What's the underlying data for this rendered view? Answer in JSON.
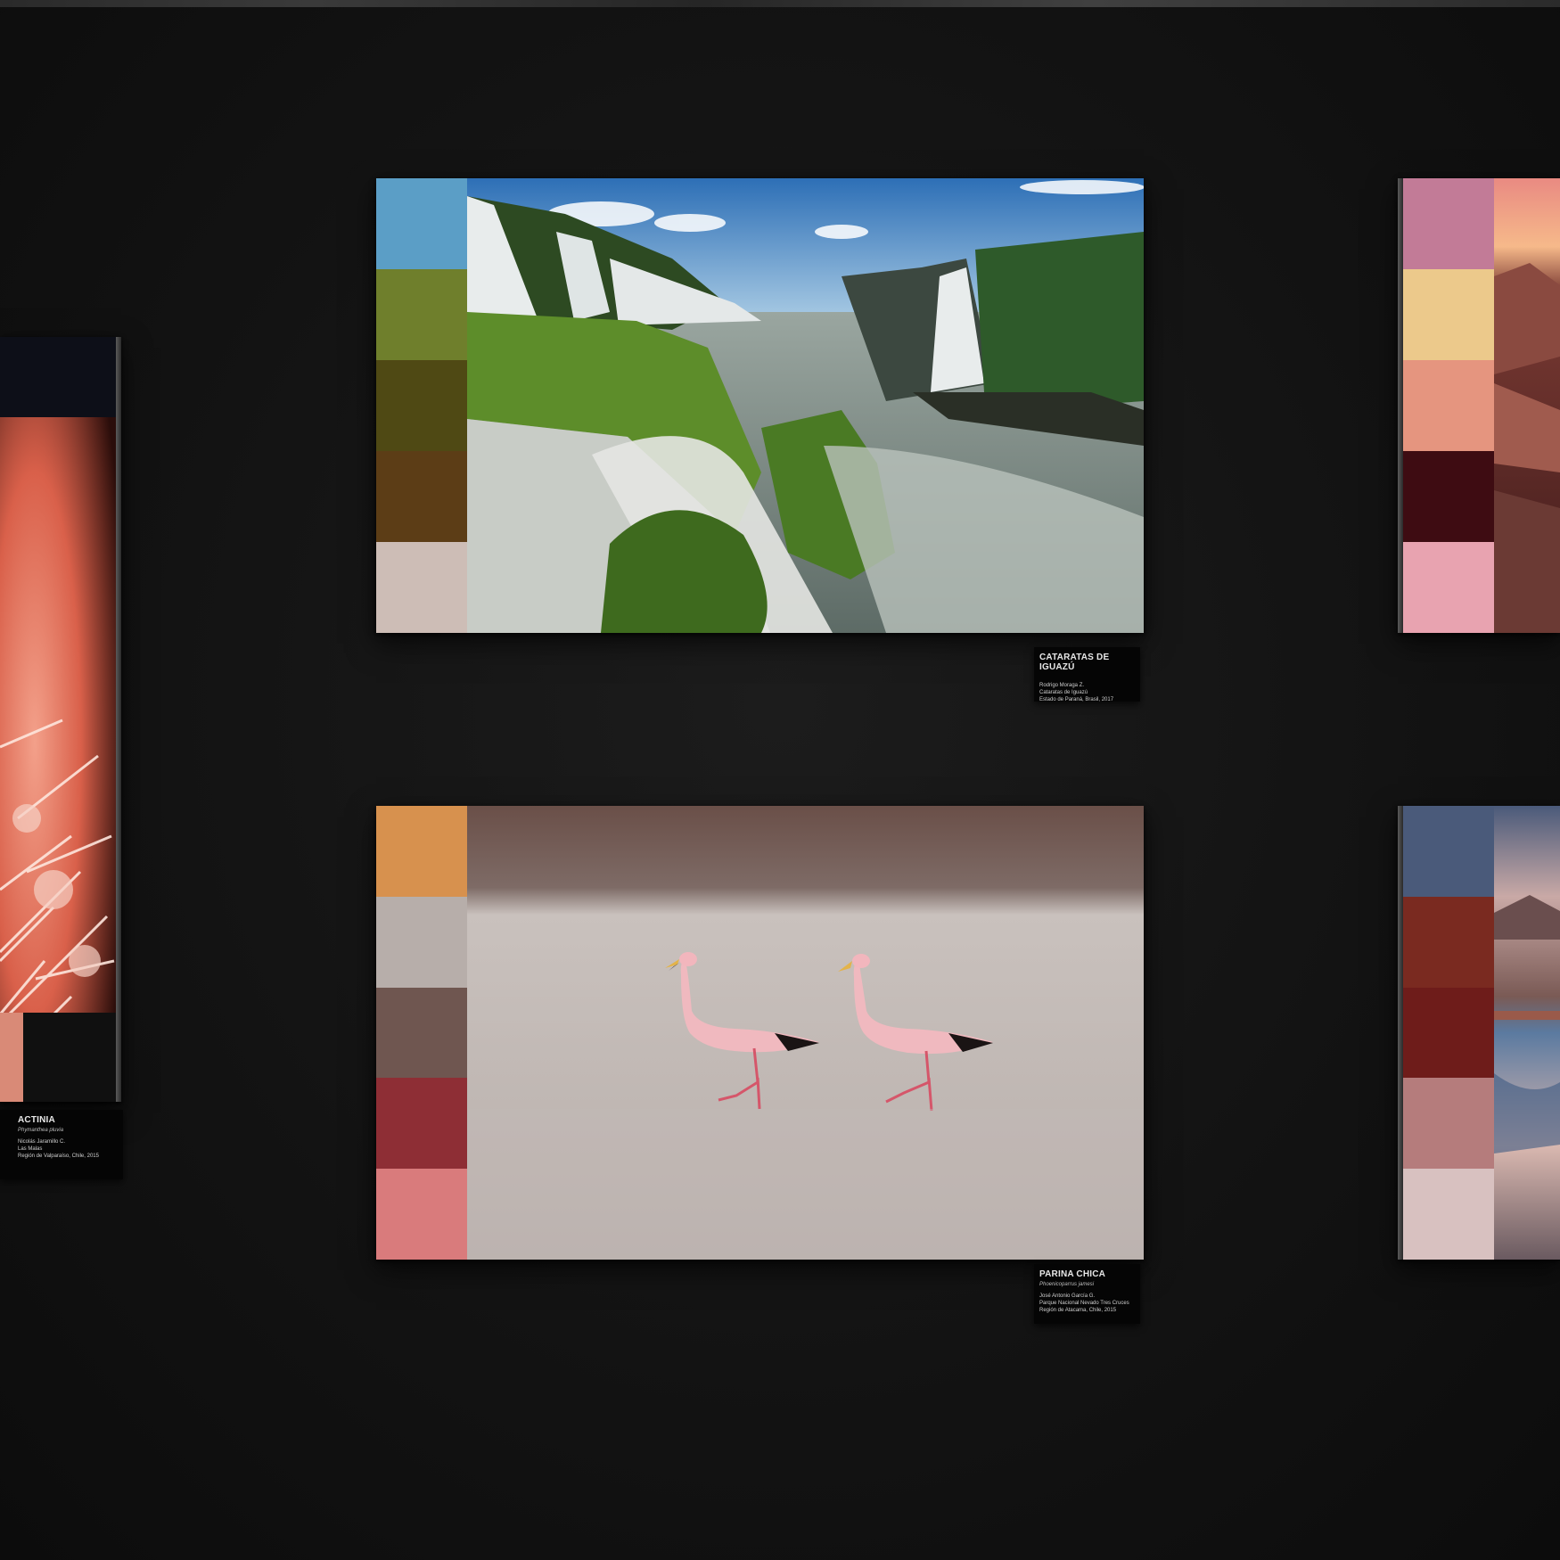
{
  "gallery": {
    "center_top": {
      "title": "CATARATAS DE IGUAZÚ",
      "lines": [
        "Rodrigo Moraga Z.",
        "Cataratas de Iguazú",
        "Estado de Paraná, Brasil, 2017"
      ],
      "palette": [
        "#5b9ec6",
        "#6f7f2c",
        "#4f4914",
        "#5c3d16",
        "#cdbdb6"
      ]
    },
    "center_bottom": {
      "title": "PARINA CHICA",
      "subtitle": "Phoenicoparrus jamesi",
      "lines": [
        "José Antonio García G.",
        "Parque Nacional Nevado Tres Cruces",
        "Región de Atacama, Chile, 2015"
      ],
      "palette": [
        "#d7914e",
        "#b7aeaa",
        "#6f5650",
        "#8e2e35",
        "#d97b7c"
      ]
    },
    "left": {
      "title": "ACTINIA",
      "subtitle": "Phymanthea pluvia",
      "lines": [
        "Nicolás Jaramillo C.",
        "Las Malas",
        "Región de Valparaíso, Chile, 2015"
      ],
      "palette": [
        "#d98a77",
        "#101010"
      ]
    },
    "right_top": {
      "palette": [
        "#c27b97",
        "#ecc98b",
        "#e5957f",
        "#3e0c12",
        "#e8a3b0"
      ]
    },
    "right_bottom": {
      "palette": [
        "#4a5a7a",
        "#7a2a20",
        "#6e1c1a",
        "#b57c7c",
        "#d8c1c0"
      ]
    }
  }
}
